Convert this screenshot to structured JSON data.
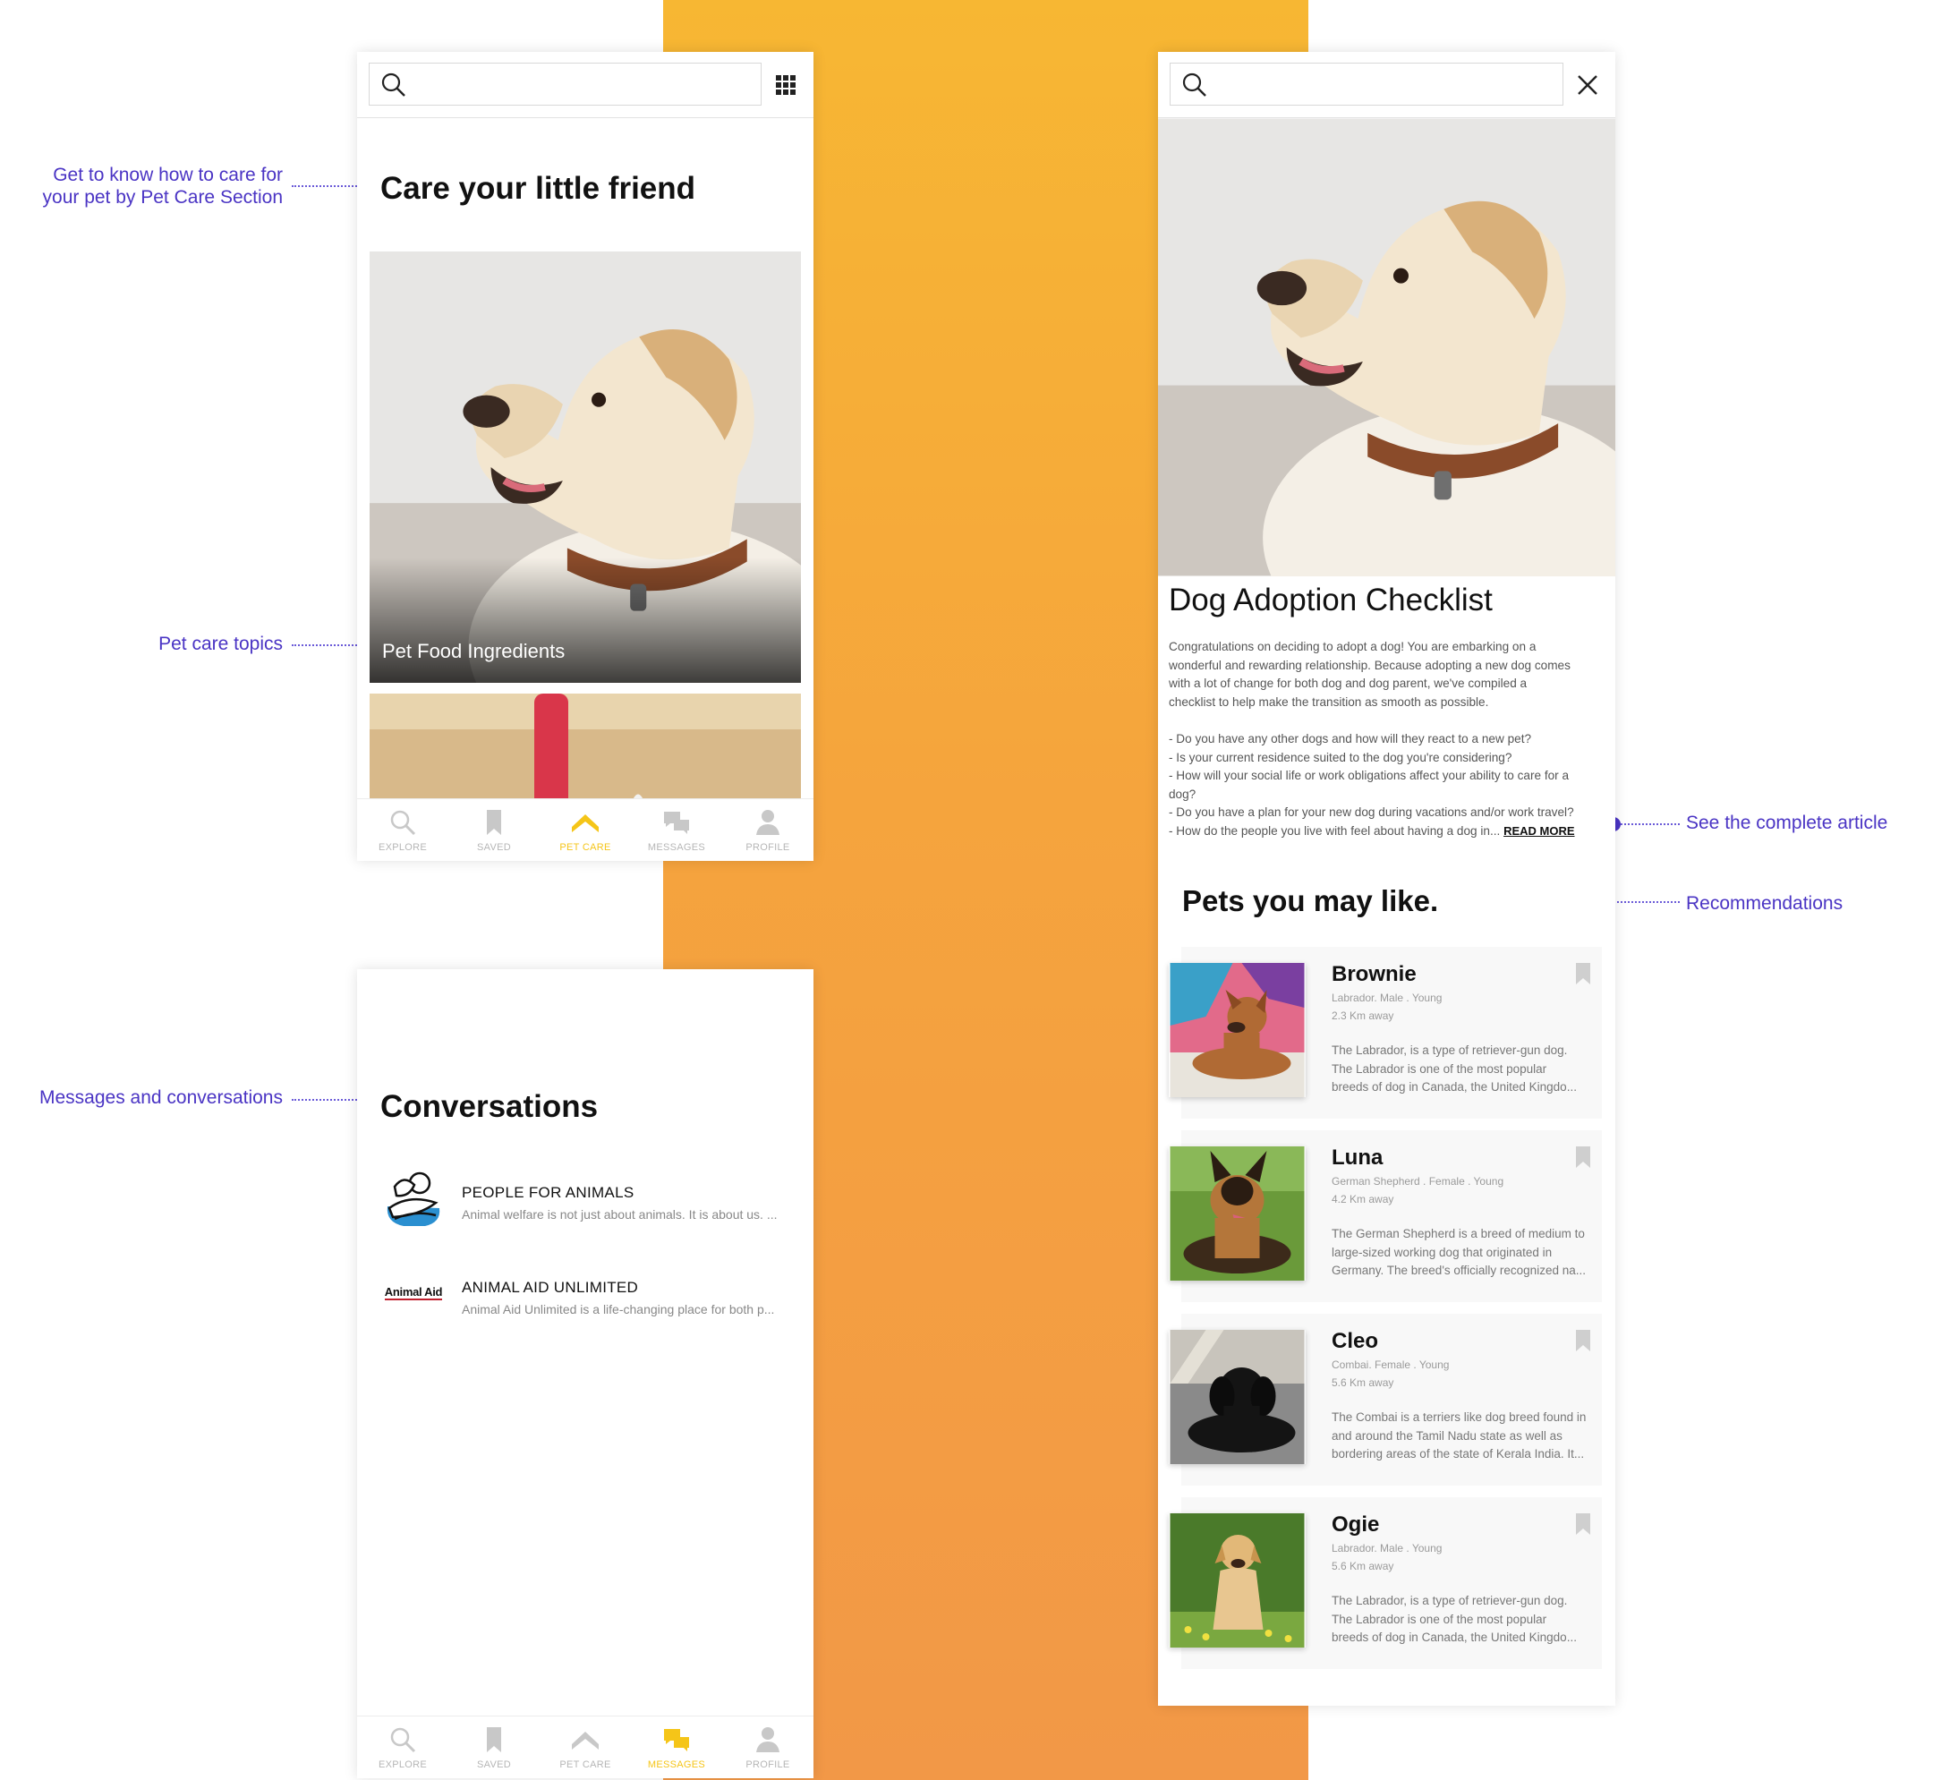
{
  "colors": {
    "accent_yellow": "#f5c518",
    "annotation_purple": "#4a34c4",
    "band_top": "#f7b733",
    "band_bottom": "#f29847"
  },
  "annotations": {
    "care": "Get to know how to care for\nyour pet  by Pet Care Section",
    "topics": "Pet care topics",
    "messages": "Messages and conversations",
    "article": "See the complete article",
    "recommendations": "Recommendations"
  },
  "pet_care_screen": {
    "title": "Care your little friend",
    "cards": [
      {
        "label": "Pet Food Ingredients"
      }
    ],
    "nav": [
      {
        "label": "EXPLORE",
        "icon": "search-icon"
      },
      {
        "label": "SAVED",
        "icon": "bookmark-icon"
      },
      {
        "label": "PET CARE",
        "icon": "pet-care-icon",
        "active": true
      },
      {
        "label": "MESSAGES",
        "icon": "messages-icon"
      },
      {
        "label": "PROFILE",
        "icon": "profile-icon"
      }
    ]
  },
  "messages_screen": {
    "title": "Conversations",
    "conversations": [
      {
        "name": "PEOPLE FOR ANIMALS",
        "message": "Animal welfare is not just about animals. It is about us. ...",
        "logo": "people-for-animals-logo"
      },
      {
        "name": "ANIMAL AID UNLIMITED",
        "message": "Animal Aid Unlimited is a life-changing place for both p...",
        "logo_text": "Animal Aid"
      }
    ],
    "nav": [
      {
        "label": "EXPLORE"
      },
      {
        "label": "SAVED"
      },
      {
        "label": "PET CARE"
      },
      {
        "label": "MESSAGES",
        "active": true
      },
      {
        "label": "PROFILE"
      }
    ]
  },
  "article_screen": {
    "title": "Dog Adoption Checklist",
    "intro": [
      "Congratulations on deciding to adopt a dog! You are embarking on a",
      "wonderful and rewarding relationship. Because adopting a new dog comes",
      "with a lot of change for both dog and dog parent, we've compiled a",
      "checklist to help make the transition as smooth as possible."
    ],
    "checklist": [
      "- Do you have any other dogs and how will they react to a new pet?",
      "- Is your current residence suited to the dog you're considering?",
      "- How will your social life or work obligations affect your ability to care for a",
      "dog?",
      "- Do you have a plan for your new dog during vacations and/or work travel?",
      "- How do the people you live with feel about having a dog in..."
    ],
    "read_more": "READ MORE",
    "recommend_title": "Pets you may like.",
    "pets": [
      {
        "name": "Brownie",
        "meta": "Labrador. Male . Young",
        "distance": "2.3 Km away",
        "desc": [
          "The Labrador, is a type of retriever-gun dog.",
          "The Labrador is one of the most popular",
          "breeds of dog in Canada, the United Kingdo..."
        ]
      },
      {
        "name": "Luna",
        "meta": "German Shepherd . Female . Young",
        "distance": "4.2 Km away",
        "desc": [
          "The German Shepherd is a breed of medium to",
          "large-sized working dog that originated in",
          "Germany. The breed's officially recognized na..."
        ]
      },
      {
        "name": "Cleo",
        "meta": "Combai. Female . Young",
        "distance": "5.6 Km away",
        "desc": [
          "The Combai is a terriers like dog breed found in",
          "and around the Tamil Nadu state as well as",
          "bordering areas of the state of Kerala India. It..."
        ]
      },
      {
        "name": "Ogie",
        "meta": "Labrador. Male . Young",
        "distance": "5.6 Km away",
        "desc": [
          "The Labrador, is a type of retriever-gun dog.",
          "The Labrador is one of the most popular",
          "breeds of dog in Canada, the United Kingdo..."
        ]
      }
    ]
  }
}
